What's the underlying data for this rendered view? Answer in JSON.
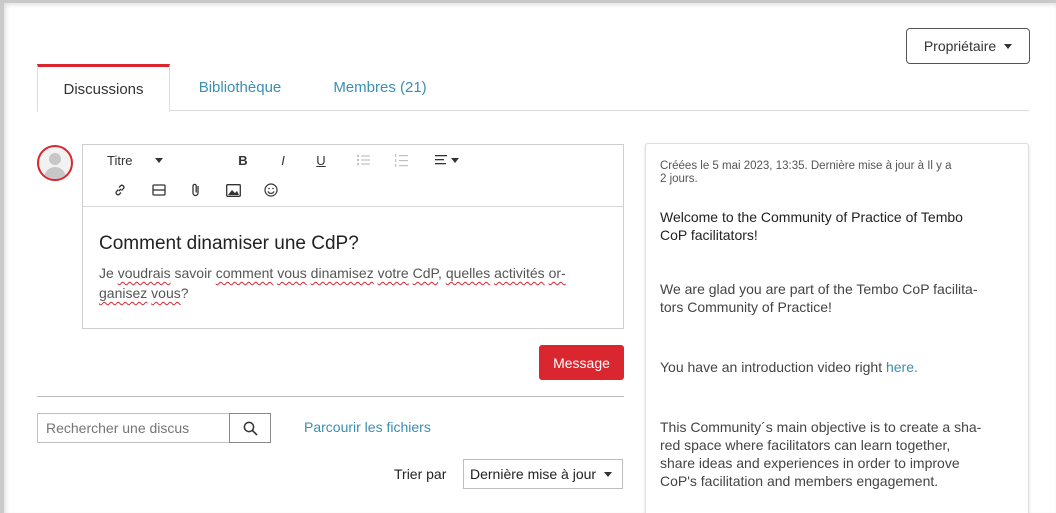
{
  "header": {
    "owner_button_label": "Propriétaire"
  },
  "tabs": [
    {
      "label": "Discussions",
      "active": true
    },
    {
      "label": "Bibliothèque",
      "active": false
    },
    {
      "label": "Membres (21)",
      "active": false
    }
  ],
  "editor": {
    "toolbar": {
      "heading_select": "Titre",
      "bold": "B",
      "italic": "I",
      "underline": "U",
      "icons": [
        "bullet-list-icon",
        "numbered-list-icon",
        "align-icon",
        "link-icon",
        "table-icon",
        "attachment-icon",
        "image-icon",
        "emoji-icon"
      ]
    },
    "subject": "Comment dinamiser une CdP?",
    "message_part1": "Je ",
    "message_w1": "voudrais",
    "message_part2": " savoir ",
    "message_w2": "comment",
    "message_part3": " ",
    "message_w3": "vous",
    "message_part4": " ",
    "message_w4": "dinamisez",
    "message_part5": " ",
    "message_w5": "votre",
    "message_part6": " ",
    "message_w6": "CdP",
    "message_part7": ", ",
    "message_w7": "quelles",
    "message_part8": " ",
    "message_w8": "activités",
    "message_part9": " ",
    "message_w9": "or-",
    "message_w10": "ganisez",
    "message_part10": " ",
    "message_w11": "vous",
    "message_part11": "?"
  },
  "send_button_label": "Message",
  "search": {
    "placeholder": "Rechercher une discus"
  },
  "browse_files_label": "Parcourir les fichiers",
  "sort": {
    "label": "Trier par",
    "selected": "Dernière mise à jour"
  },
  "panel": {
    "meta_line1": "Créées le 5 mai 2023, 13:35. Dernière mise à jour à Il y a",
    "meta_line2": "2 jours.",
    "welcome_line1": "Welcome to the Community of Practice of Tembo",
    "welcome_line2": "CoP facilitators!",
    "glad_line1": "We are glad you are part of the Tembo CoP facilita-",
    "glad_line2": "tors Community of Practice!",
    "video_text": "You have an introduction video right ",
    "video_link": "here.",
    "objective_line1": "This Community´s main objective is to create a sha-",
    "objective_line2": "red space where facilitators can learn together,",
    "objective_line3": "share ideas and experiences in order to improve",
    "objective_line4": "CoP's facilitation and members engagement."
  },
  "colors": {
    "accent": "#d9262f",
    "link": "#3b8fb0"
  }
}
